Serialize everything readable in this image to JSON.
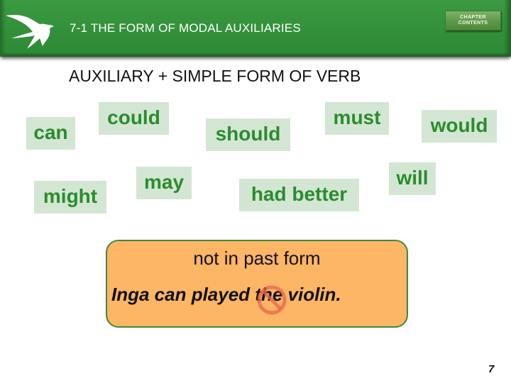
{
  "header": {
    "logo_icon": "swallow-bird-icon",
    "slide_title": "7-1 THE FORM OF MODAL AUXILIARIES",
    "chapter_button": {
      "line1": "CHAPTER",
      "line2": "CONTENTS"
    }
  },
  "subtitle": "AUXILIARY + SIMPLE FORM OF VERB",
  "modals": [
    {
      "label": "can"
    },
    {
      "label": "could"
    },
    {
      "label": "should"
    },
    {
      "label": "must"
    },
    {
      "label": "would"
    },
    {
      "label": "might"
    },
    {
      "label": "may"
    },
    {
      "label": "had better"
    },
    {
      "label": "will"
    }
  ],
  "rule": {
    "title": "not in past form",
    "example": "Inga can played the violin.",
    "error_icon": "no-sign-icon"
  },
  "page_number": "7",
  "colors": {
    "header_green": "#33913b",
    "word_text_green": "#2b8c2e",
    "word_background": "#d3e6d3",
    "rule_box_orange": "#fdb566",
    "rule_box_border": "#3f8a3a",
    "no_sign_red": "#e8654a"
  }
}
